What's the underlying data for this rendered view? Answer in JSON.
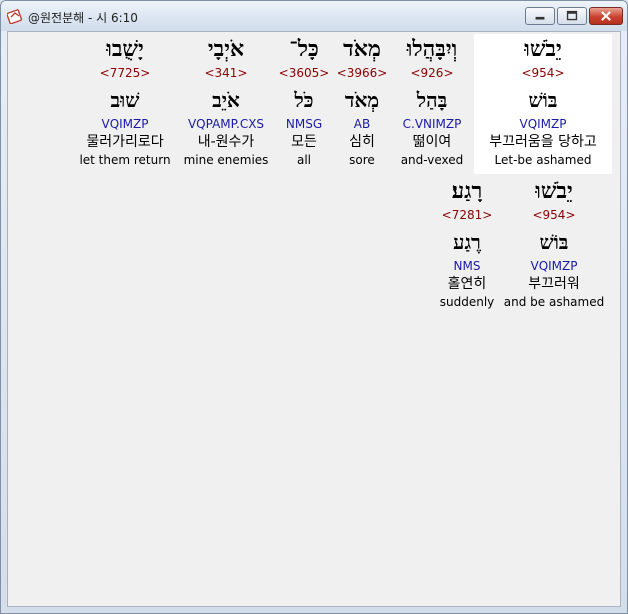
{
  "window": {
    "title": "@원전분해 - 시 6:10",
    "controls": {
      "minimize": "minimize",
      "maximize": "maximize",
      "close": "close"
    }
  },
  "verse": {
    "line1": [
      {
        "hebrew": "יֵבֹשׁוּ",
        "strong": "<954>",
        "lemma": "בּוֹשׁ",
        "morph": "VQIMZP",
        "korean": "부끄러움을 당하고",
        "english": "Let-be ashamed",
        "selected": true
      },
      {
        "hebrew": "וְיִבָּהֲלוּ",
        "strong": "<926>",
        "lemma": "בָּהַל",
        "morph": "C.VNIMZP",
        "korean": "떪이여",
        "english": "and-vexed"
      },
      {
        "hebrew": "מְאֹד",
        "strong": "<3966>",
        "lemma": "מְאֹד",
        "morph": "AB",
        "korean": "심히",
        "english": "sore"
      },
      {
        "hebrew": "כָּל־",
        "strong": "<3605>",
        "lemma": "כֹּל",
        "morph": "NMSG",
        "korean": "모든",
        "english": "all"
      },
      {
        "hebrew": "אֹיְבָי",
        "strong": "<341>",
        "lemma": "אֹיֵב",
        "morph": "VQPAMP.CXS",
        "korean": "내-원수가",
        "english": "mine enemies"
      },
      {
        "hebrew": "יָשֻׁבוּ",
        "strong": "<7725>",
        "lemma": "שׁוּב",
        "morph": "VQIMZP",
        "korean": "물러가리로다",
        "english": "let them return"
      }
    ],
    "line2": [
      {
        "hebrew": "יֵבֹשׁוּ",
        "strong": "<954>",
        "lemma": "בּוֹשׁ",
        "morph": "VQIMZP",
        "korean": "부끄러워",
        "english": "and be ashamed"
      },
      {
        "hebrew": "רָגַע׃",
        "strong": "<7281>",
        "lemma": "רֶגַע",
        "morph": "NMS",
        "korean": "홀연히",
        "english": "suddenly"
      }
    ]
  }
}
